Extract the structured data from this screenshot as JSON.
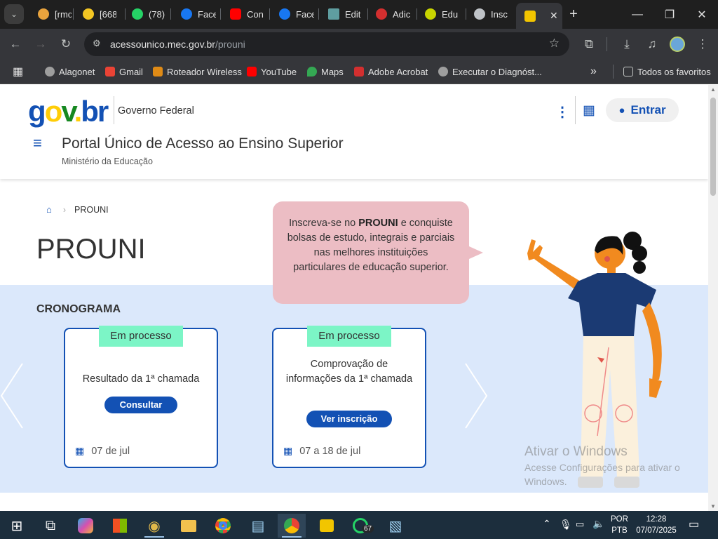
{
  "browser": {
    "tabs": [
      {
        "label": "[rmc",
        "icon": "podcast-icon"
      },
      {
        "label": "[668",
        "icon": "coin-icon"
      },
      {
        "label": "(78)",
        "icon": "whatsapp-icon"
      },
      {
        "label": "Face",
        "icon": "facebook-icon"
      },
      {
        "label": "Con",
        "icon": "youtube-icon"
      },
      {
        "label": "Face",
        "icon": "facebook-icon"
      },
      {
        "label": "Edit",
        "icon": "document-icon"
      },
      {
        "label": "Adic",
        "icon": "adobe-icon"
      },
      {
        "label": "Edu",
        "icon": "circle-icon"
      },
      {
        "label": "Insc",
        "icon": "globe-icon"
      },
      {
        "label": "",
        "icon": "gov-icon",
        "active": true
      }
    ],
    "url_host": "acessounico.mec.gov.br",
    "url_path": "/prouni",
    "bookmarks": [
      {
        "label": "Alagonet",
        "color": "#9e9e9e"
      },
      {
        "label": "Gmail",
        "color": "#ea4335"
      },
      {
        "label": "Roteador Wireless",
        "color": "#e08b16"
      },
      {
        "label": "YouTube",
        "color": "#ff0000"
      },
      {
        "label": "Maps",
        "color": "#34a853"
      },
      {
        "label": "Adobe Acrobat",
        "color": "#d32f2f"
      },
      {
        "label": "Executar o Diagnóst...",
        "color": "#9e9e9e"
      }
    ],
    "all_bookmarks": "Todos os favoritos"
  },
  "site": {
    "logo": {
      "g": "g",
      "o": "o",
      "v": "v",
      "dot": ".",
      "br": "br"
    },
    "gov_label": "Governo Federal",
    "login_label": "Entrar",
    "portal_title": "Portal Único de Acesso ao Ensino Superior",
    "ministry": "Ministério da Educação",
    "breadcrumb_current": "PROUNI",
    "page_title": "PROUNI",
    "bubble": {
      "pre": "Inscreva-se no ",
      "bold": "PROUNI",
      "post": " e conquiste bolsas de estudo, integrais e parciais nas melhores instituições particulares de educação superior."
    },
    "section_title": "CRONOGRAMA",
    "cards": [
      {
        "badge": "Em processo",
        "title": "Resultado da 1ª chamada",
        "button": "Consultar",
        "date": "07 de jul"
      },
      {
        "badge": "Em processo",
        "title": "Comprovação de informações da 1ª chamada",
        "button": "Ver inscrição",
        "date": "07 a 18 de jul"
      }
    ]
  },
  "watermark": {
    "title": "Ativar o Windows",
    "line1": "Acesse Configurações para ativar o",
    "line2": "Windows."
  },
  "taskbar": {
    "whatsapp_badge": "67",
    "lang_top": "POR",
    "lang_bottom": "PTB",
    "time": "12:28",
    "date": "07/07/2025"
  }
}
